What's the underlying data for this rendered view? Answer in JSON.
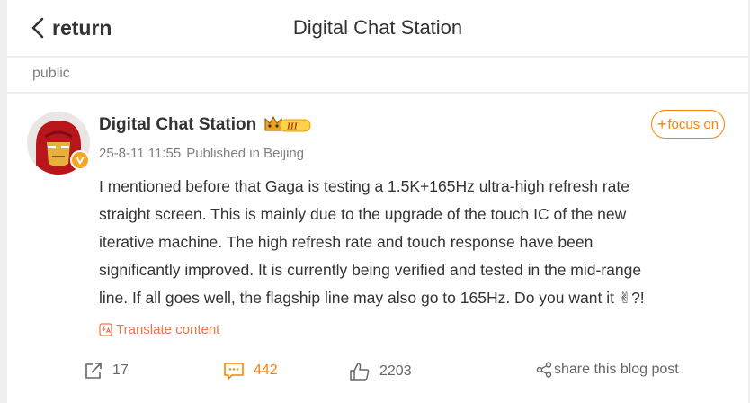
{
  "header": {
    "back_label": "return",
    "title": "Digital Chat Station"
  },
  "scope": {
    "label": "public"
  },
  "post": {
    "author": "Digital Chat Station",
    "timestamp": "25-8-11 11:55",
    "location": "Published in Beijing",
    "follow_label": "focus on",
    "body_lines": [
      "I mentioned before that Gaga is testing a 1.5K+165Hz ultra-high refresh rate",
      "straight screen. This is mainly due to the upgrade of the touch IC of the new",
      "iterative machine. The high refresh rate and touch response have been",
      "significantly improved. It is currently being verified and tested in the mid-range",
      "line. If all goes well, the flagship line may also go to 165Hz. Do you want it "
    ],
    "body_emoji": "✌",
    "body_tail": "?!",
    "translate_label": "Translate content"
  },
  "actions": {
    "repost_count": "17",
    "comment_count": "442",
    "like_count": "2203",
    "share_label": "share this blog post"
  },
  "colors": {
    "accent": "#ff8200",
    "translate": "#eb7350",
    "meta": "#808080",
    "background": "#f0f0f0"
  },
  "icons": [
    "chevron-left-icon",
    "crown-icon",
    "verified-icon",
    "translate-icon",
    "repost-icon",
    "comment-icon",
    "like-icon",
    "share-icon"
  ]
}
